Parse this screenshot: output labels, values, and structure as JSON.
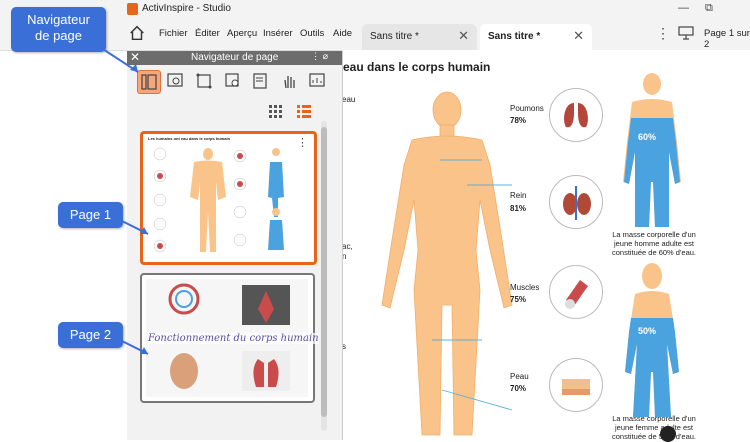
{
  "app": {
    "title": "ActivInspire - Studio"
  },
  "menu": [
    "Fichier",
    "Éditer",
    "Aperçu",
    "Insérer",
    "Outils",
    "Aide"
  ],
  "menu_underline": [
    "F",
    "É",
    "A",
    "I",
    "O",
    "A"
  ],
  "tabs": [
    {
      "label": "Sans titre *",
      "active": false
    },
    {
      "label": "Sans titre *",
      "active": true
    }
  ],
  "page_indicator": "Page 1 sur 2",
  "navigator": {
    "title": "Navigateur de page",
    "tools": [
      "page-view-icon",
      "image-search-icon",
      "crop-icon",
      "zoom-icon",
      "page-list-icon",
      "hand-icon",
      "chart-icon"
    ],
    "pages": [
      {
        "number": 1,
        "thumb_title": "Les humains ont eau dans le corps humain"
      },
      {
        "number": 2,
        "thumb_title": "Fonctionnement du corps humain"
      }
    ]
  },
  "callouts": {
    "navigator": "Navigateur de page",
    "page1": "Page 1",
    "page2": "Page 2"
  },
  "content": {
    "title_fragment": "eau dans le corps humain",
    "left_fragments": [
      "eau",
      "ac,",
      "n",
      "s"
    ],
    "organs": [
      {
        "name": "Poumons",
        "value": "78%"
      },
      {
        "name": "Rein",
        "value": "81%"
      },
      {
        "name": "Muscles",
        "value": "75%"
      },
      {
        "name": "Peau",
        "value": "70%"
      }
    ],
    "man_percent": "60%",
    "man_note": "La masse corporelle d'un jeune homme adulte est constituée de 60% d'eau.",
    "woman_percent": "50%",
    "woman_note": "La masse corporelle d'un jeune femme adulte est constituée de 50% d'eau."
  }
}
